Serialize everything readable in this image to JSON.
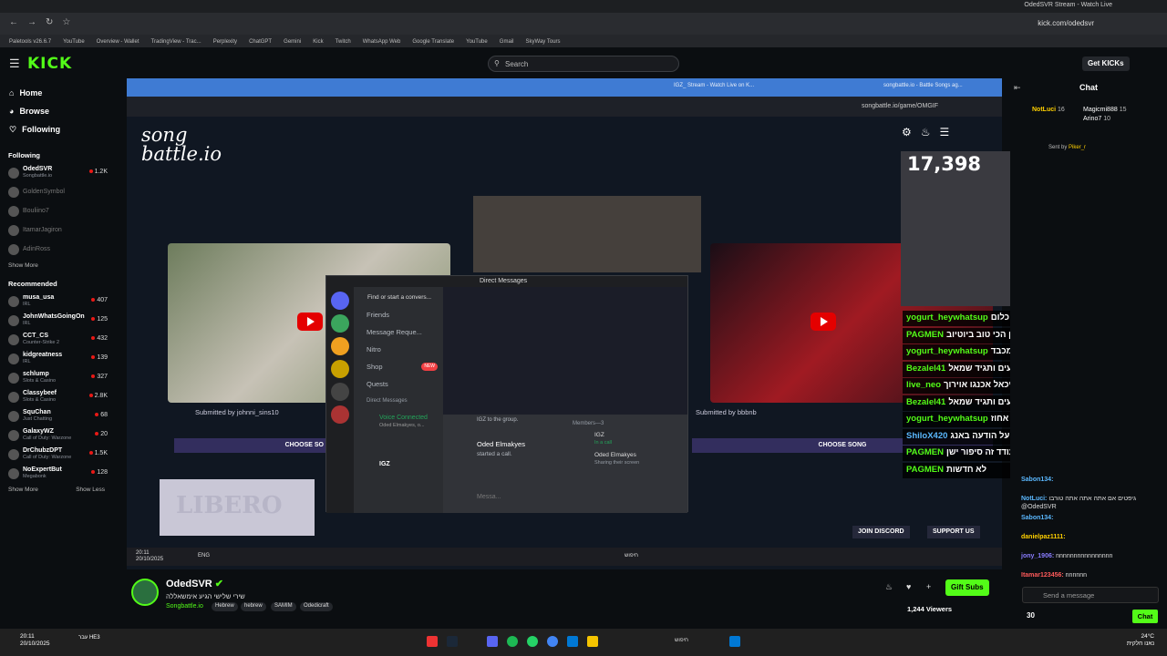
{
  "browser": {
    "tab_title": "OdedSVR Stream - Watch Live",
    "url": "kick.com/odedsvr",
    "bookmarks": [
      "Paletools v26.6.7",
      "YouTube",
      "Overview - Wallet",
      "TradingView - Trac...",
      "Perplexity",
      "ChatGPT",
      "Gemini",
      "Kick",
      "Twitch",
      "WhatsApp Web",
      "Google Translate",
      "YouTube",
      "Gmail",
      "SkyWay Tours"
    ]
  },
  "header": {
    "logo": "KICK",
    "search_placeholder": "Search",
    "get_kicks": "Get KICKs"
  },
  "sidebar": {
    "nav": [
      {
        "icon": "home-icon",
        "label": "Home"
      },
      {
        "icon": "compass-icon",
        "label": "Browse"
      },
      {
        "icon": "heart-icon",
        "label": "Following"
      }
    ],
    "following_title": "Following",
    "following": [
      {
        "name": "OdedSVR",
        "sub": "Songbattle.io",
        "count": "1.2K",
        "live": true
      },
      {
        "name": "GoldenSymbol",
        "sub": "",
        "count": "",
        "live": false
      },
      {
        "name": "Bouliino7",
        "sub": "",
        "count": "",
        "live": false
      },
      {
        "name": "ItamarJagiron",
        "sub": "",
        "count": "",
        "live": false
      },
      {
        "name": "AdinRoss",
        "sub": "",
        "count": "",
        "live": false
      }
    ],
    "show_more": "Show More",
    "recommended_title": "Recommended",
    "recommended": [
      {
        "name": "musa_usa",
        "sub": "IRL",
        "count": "407"
      },
      {
        "name": "JohnWhatsGoingOn",
        "sub": "IRL",
        "count": "125"
      },
      {
        "name": "CCT_CS",
        "sub": "Counter-Strike 2",
        "count": "432"
      },
      {
        "name": "kidgreatness",
        "sub": "IRL",
        "count": "139"
      },
      {
        "name": "schlump",
        "sub": "Slots & Casino",
        "count": "327"
      },
      {
        "name": "Classybeef",
        "sub": "Slots & Casino",
        "count": "2.8K"
      },
      {
        "name": "SquChan",
        "sub": "Just Chatting",
        "count": "68"
      },
      {
        "name": "GalaxyWZ",
        "sub": "Call of Duty: Warzone",
        "count": "20"
      },
      {
        "name": "DrChubzDPT",
        "sub": "Call of Duty: Warzone",
        "count": "1.5K"
      },
      {
        "name": "NoExpertBut",
        "sub": "Megabonk",
        "count": "128"
      }
    ],
    "show_more2": "Show More",
    "show_less": "Show Less"
  },
  "video": {
    "inner_url": "songbattle.io/game/OMGIF",
    "inner_tabs": [
      "IGZ_ Stream - Watch Live on K...",
      "songbattle.io - Battle Songs ag..."
    ],
    "site_logo_1": "song",
    "site_logo_2": "battle.io",
    "left_submitted": "Submitted by johnni_sins10",
    "right_submitted": "Submitted by bbbnb",
    "choose_left": "CHOOSE SO",
    "choose_right": "CHOOSE SONG",
    "join_discord": "JOIN DISCORD",
    "support_us": "SUPPORT US",
    "big_count": "17,398",
    "libero": "LIBERO",
    "inner_clock": "20:11",
    "inner_date": "20/10/2025",
    "inner_lang": "ENG",
    "inner_search": "חיפוש"
  },
  "discord": {
    "title": "Direct Messages",
    "find": "Find or start a convers...",
    "items": [
      {
        "label": "Friends",
        "badge": ""
      },
      {
        "label": "Message Reque...",
        "badge": ""
      },
      {
        "label": "Nitro",
        "badge": ""
      },
      {
        "label": "Shop",
        "badge": "NEW"
      },
      {
        "label": "Quests",
        "badge": ""
      }
    ],
    "dm_header": "Direct Messages",
    "voice": "Voice Connected",
    "voice_sub": "Oded Elmakyes, o...",
    "user": "IGZ",
    "caller": "Oded Elmakyes",
    "call_text": "started a call.",
    "to_group": "IGZ to the group.",
    "members": "Members—3",
    "member1": "IGZ",
    "member1_sub": "In a call",
    "member2": "Oded Elmakyes",
    "member2_sub": "Sharing their screen",
    "message_placeholder": "Messa..."
  },
  "overlay_chat": [
    {
      "user": "yogurt_heywhatsup",
      "color": "#53fc18",
      "text": "אותי עומר שיכנע אותי ולא מציעים לי כלום"
    },
    {
      "user": "PAGMEN",
      "color": "#53fc18",
      "text": "לדעתי רוקן הערוך דין הכי טוב ביוטיוב"
    },
    {
      "user": "yogurt_heywhatsup",
      "color": "#53fc18",
      "text": "הפגר היחיד שאני מכבד"
    },
    {
      "user": "Bezalel41",
      "color": "#53fc18",
      "text": "דפוק סקאם דקה תשעים ותגיד שמאל @ODEDSVR @"
    },
    {
      "user": "live_neo",
      "color": "#53fc18",
      "text": "מיכאל אכנגו אוירוך"
    },
    {
      "user": "Bezalel41",
      "color": "#53fc18",
      "text": "דפוק סקאם דקה תשעים ותגיד שמאל @ODEDSVR @"
    },
    {
      "user": "yogurt_heywhatsup",
      "color": "#53fc18",
      "text": "ואני מסכים בשביל 100 אחוז"
    },
    {
      "user": "ShiloX420",
      "color": "#5bb8ff",
      "text": "דך שאתה חושב שאני חייב לך 5 גיפטים על הודעה באנג"
    },
    {
      "user": "PAGMEN",
      "color": "#53fc18",
      "text": "יודעים שאמא של מיכאל דלוקה על עודד זה סיפור ישן"
    },
    {
      "user": "PAGMEN",
      "color": "#53fc18",
      "text": "לא חדשות"
    }
  ],
  "chat": {
    "title": "Chat",
    "top": [
      {
        "user": "NotLuci",
        "val": "16"
      },
      {
        "user": "Magicmi888",
        "val": "15"
      },
      {
        "user": "Arino7",
        "val": "10"
      }
    ],
    "sent_by": "Sent by",
    "sent_user": "Piker_r",
    "messages": [
      {
        "user": "Sabon134:",
        "text": "",
        "color": "#5bb8ff"
      },
      {
        "user": "NotLuci:",
        "text": "גיפטים אם אתה אתה אתה טורבו @OdedSVR",
        "color": "#5bb8ff"
      },
      {
        "user": "Sabon134:",
        "text": "",
        "color": "#5bb8ff"
      },
      {
        "user": "danielpaz1111:",
        "text": "",
        "color": "#ffd000"
      },
      {
        "user": "jony_1906:",
        "text": "nnnnnnnnnnnnnnnn",
        "color": "#8a7dff"
      },
      {
        "user": "Itamar123456:",
        "text": "nnnnnn",
        "color": "#ff5a5a"
      }
    ],
    "send_placeholder": "Send a message",
    "points": "30",
    "chat_button": "Chat"
  },
  "streamer": {
    "name": "OdedSVR",
    "title": "שירי שלישי הגיע אימשאללה",
    "category": "Songbattle.io",
    "tags": [
      "Hebrew",
      "hebrew",
      "SAMIM",
      "Odedicraft"
    ],
    "gift_subs": "Gift Subs",
    "viewers": "1,244 Viewers"
  },
  "taskbar": {
    "time": "20:11",
    "date": "20/10/2025",
    "lang": "עבר HE3",
    "search": "חיפוש",
    "weather": "24°C",
    "weather_sub": "נאנו חלקית"
  }
}
